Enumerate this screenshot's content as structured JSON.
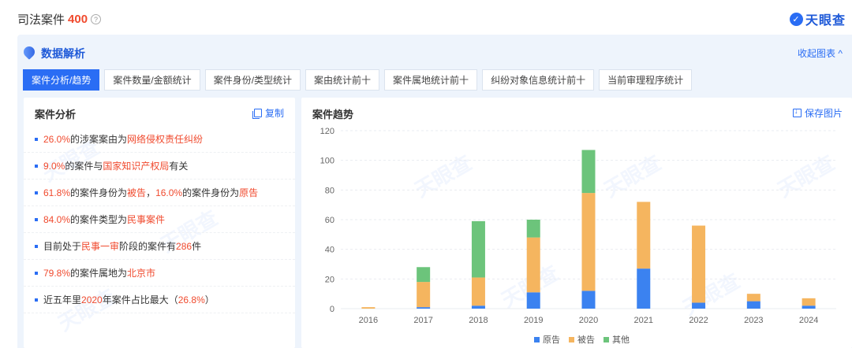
{
  "header": {
    "title": "司法案件",
    "count": "400",
    "help_icon": "question-circle-icon",
    "brand": "天眼查",
    "brand_icon": "tianyancha-logo"
  },
  "panel": {
    "title": "数据解析",
    "collapse": "收起图表",
    "collapse_icon": "chevron-up-icon"
  },
  "tabs": [
    {
      "label": "案件分析/趋势",
      "active": true
    },
    {
      "label": "案件数量/金额统计"
    },
    {
      "label": "案件身份/类型统计"
    },
    {
      "label": "案由统计前十"
    },
    {
      "label": "案件属地统计前十"
    },
    {
      "label": "纠纷对象信息统计前十"
    },
    {
      "label": "当前审理程序统计"
    }
  ],
  "analysis": {
    "title": "案件分析",
    "copy": "复制",
    "items": [
      [
        {
          "t": "26.0%",
          "hl": true
        },
        {
          "t": "的涉案案由为"
        },
        {
          "t": "网络侵权责任纠纷",
          "hl": true
        }
      ],
      [
        {
          "t": "9.0%",
          "hl": true
        },
        {
          "t": "的案件与"
        },
        {
          "t": "国家知识产权局",
          "hl": true
        },
        {
          "t": "有关"
        }
      ],
      [
        {
          "t": "61.8%",
          "hl": true
        },
        {
          "t": "的案件身份为"
        },
        {
          "t": "被告",
          "hl": true
        },
        {
          "t": "，"
        },
        {
          "t": "16.0%",
          "hl": true
        },
        {
          "t": "的案件身份为"
        },
        {
          "t": "原告",
          "hl": true
        }
      ],
      [
        {
          "t": "84.0%",
          "hl": true
        },
        {
          "t": "的案件类型为"
        },
        {
          "t": "民事案件",
          "hl": true
        }
      ],
      [
        {
          "t": "目前处于"
        },
        {
          "t": "民事一审",
          "hl": true
        },
        {
          "t": "阶段的案件有"
        },
        {
          "t": "286",
          "hl": true
        },
        {
          "t": "件"
        }
      ],
      [
        {
          "t": "79.8%",
          "hl": true
        },
        {
          "t": "的案件属地为"
        },
        {
          "t": "北京市",
          "hl": true
        }
      ],
      [
        {
          "t": "近五年里"
        },
        {
          "t": "2020",
          "hl": true
        },
        {
          "t": "年案件占比最大（"
        },
        {
          "t": "26.8%",
          "hl": true
        },
        {
          "t": "）"
        }
      ]
    ]
  },
  "trend": {
    "title": "案件趋势",
    "save": "保存图片"
  },
  "chart_data": {
    "type": "bar",
    "stacked": true,
    "categories": [
      "2016",
      "2017",
      "2018",
      "2019",
      "2020",
      "2021",
      "2022",
      "2023",
      "2024"
    ],
    "series": [
      {
        "name": "原告",
        "color": "#3b82f0",
        "values": [
          0,
          1,
          2,
          11,
          12,
          27,
          4,
          5,
          2
        ]
      },
      {
        "name": "被告",
        "color": "#f5b55f",
        "values": [
          1,
          17,
          19,
          37,
          66,
          45,
          52,
          5,
          5
        ]
      },
      {
        "name": "其他",
        "color": "#6cc47b",
        "values": [
          0,
          10,
          38,
          12,
          29,
          0,
          0,
          0,
          0
        ]
      }
    ],
    "ylim": [
      0,
      120
    ],
    "yticks": [
      0,
      20,
      40,
      60,
      80,
      100,
      120
    ],
    "grid": true,
    "legend_position": "bottom-center",
    "title": "",
    "xlabel": "",
    "ylabel": ""
  }
}
